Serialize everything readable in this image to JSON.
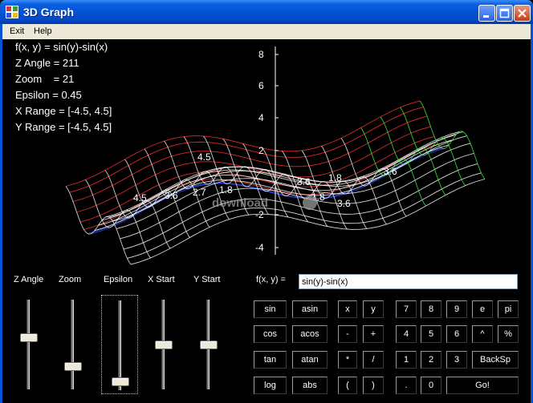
{
  "window": {
    "title": "3D Graph",
    "icon": "graph-app-icon"
  },
  "menu": {
    "items": [
      "Exit",
      "Help"
    ]
  },
  "info": {
    "lines": [
      "f(x, y) = sin(y)-sin(x)",
      "Z Angle = 211",
      "Zoom    = 21",
      "Epsilon = 0.45",
      "X Range = [-4.5, 4.5]",
      "Y Range = [-4.5, 4.5]"
    ]
  },
  "graph": {
    "z_ticks": [
      "8",
      "6",
      "4",
      "2",
      "-2",
      "-4"
    ],
    "axis_labels": [
      "4.5",
      "3.6",
      "2.7",
      "1.8",
      "1.8",
      "3.6",
      "3.6",
      "1.8",
      "3.6",
      "4.5"
    ],
    "watermark": "download"
  },
  "sliders": [
    {
      "label": "Z Angle",
      "level": 0.42
    },
    {
      "label": "Zoom",
      "level": 0.77
    },
    {
      "label": "Epsilon",
      "level": 0.95
    },
    {
      "label": "X Start",
      "level": 0.5
    },
    {
      "label": "Y Start",
      "level": 0.5
    }
  ],
  "function": {
    "label": "f(x, y) =",
    "value": "sin(y)-sin(x)"
  },
  "keypad": {
    "row1": [
      "sin",
      "asin",
      "x",
      "y",
      "7",
      "8",
      "9",
      "e",
      "pi"
    ],
    "row2": [
      "cos",
      "acos",
      "-",
      "+",
      "4",
      "5",
      "6",
      "^",
      "%"
    ],
    "row3": [
      "tan",
      "atan",
      "*",
      "/",
      "1",
      "2",
      "3",
      "BackSp"
    ],
    "row4": [
      "log",
      "abs",
      "(",
      ")",
      ".",
      "0",
      "Go!"
    ]
  },
  "colors": {
    "titlebar": "#0553d6",
    "background": "#000000",
    "grid_front": "#ffffff",
    "grid_red": "#ff3030",
    "grid_blue": "#3050ff",
    "grid_green": "#40ff40"
  }
}
